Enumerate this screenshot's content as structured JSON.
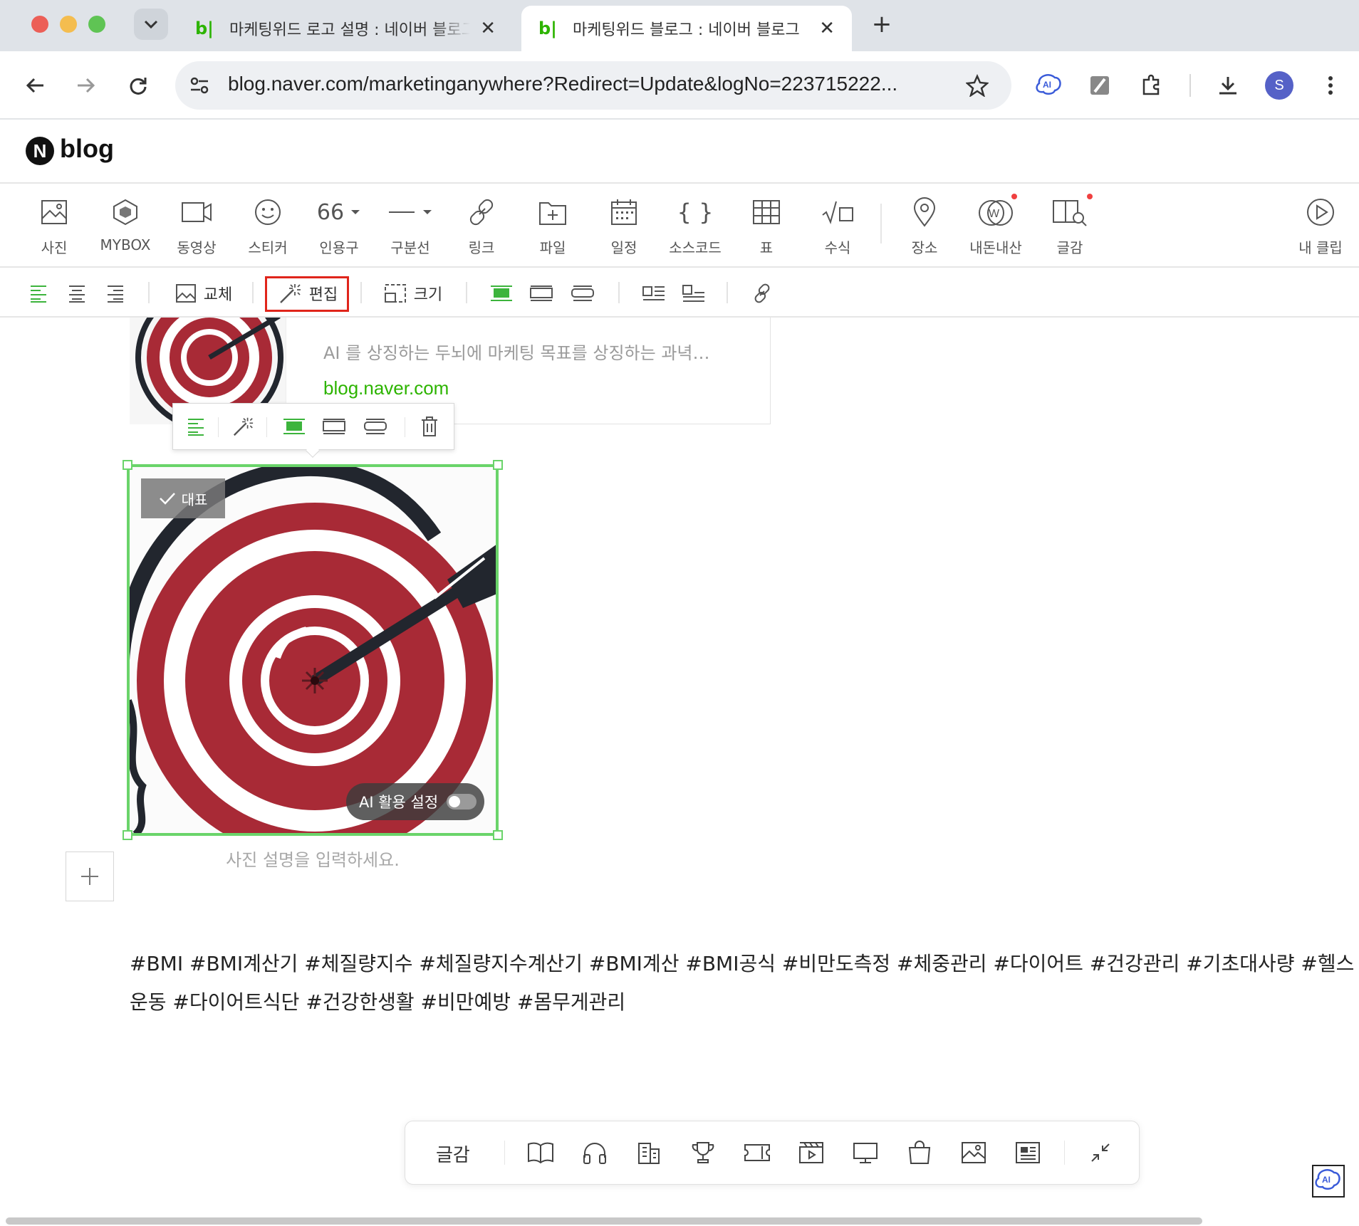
{
  "browser": {
    "tabs": [
      {
        "favicon": "b|",
        "title": "마케팅위드 로고 설명 : 네이버 블로그"
      },
      {
        "favicon": "b|",
        "title": "마케팅위드 블로그 : 네이버 블로그"
      }
    ],
    "tab_close": "✕",
    "new_tab": "+",
    "url": "blog.naver.com/marketinganywhere?Redirect=Update&logNo=223715222...",
    "profile_initial": "S",
    "ai_ext_label": "AI"
  },
  "blog": {
    "logo_letter": "N",
    "logo_word": "blog"
  },
  "insert_toolbar": {
    "items": [
      {
        "label": "사진",
        "icon": "photo-icon"
      },
      {
        "label": "MYBOX",
        "icon": "mybox-icon"
      },
      {
        "label": "동영상",
        "icon": "video-icon"
      },
      {
        "label": "스티커",
        "icon": "sticker-icon"
      },
      {
        "label": "인용구",
        "icon": "quote-icon",
        "glyph": "66"
      },
      {
        "label": "구분선",
        "icon": "divider-icon"
      },
      {
        "label": "링크",
        "icon": "link-icon"
      },
      {
        "label": "파일",
        "icon": "file-icon"
      },
      {
        "label": "일정",
        "icon": "calendar-icon"
      },
      {
        "label": "소스코드",
        "icon": "code-icon",
        "glyph": "{ }"
      },
      {
        "label": "표",
        "icon": "table-icon"
      },
      {
        "label": "수식",
        "icon": "formula-icon"
      },
      {
        "label": "장소",
        "icon": "place-icon"
      },
      {
        "label": "내돈내산",
        "icon": "my-money-icon",
        "glyph": "W"
      },
      {
        "label": "글감",
        "icon": "material-icon"
      },
      {
        "label": "내 클립",
        "icon": "clip-icon"
      }
    ]
  },
  "format_toolbar": {
    "replace_label": "교체",
    "edit_label": "편집",
    "size_label": "크기"
  },
  "content": {
    "link_card": {
      "description": "AI 를 상징하는 두뇌에 마케팅 목표를 상징하는 과녁…",
      "domain": "blog.naver.com"
    },
    "image": {
      "representative_label": "대표",
      "ai_setting_label": "AI 활용 설정",
      "caption_placeholder": "사진 설명을 입력하세요."
    },
    "hashtags_line1": "#BMI #BMI계산기 #체질량지수 #체질량지수계산기 #BMI계산 #BMI공식 #비만도측정 #체중관리 #다이어트 #건강관리 #기초대사량 #헬스",
    "hashtags_line2": "운동 #다이어트식단 #건강한생활 #비만예방 #몸무게관리"
  },
  "bottom_bar": {
    "label": "글감",
    "icons": [
      "book-icon",
      "music-icon",
      "building-icon",
      "trophy-icon",
      "ticket-icon",
      "movie-icon",
      "tv-icon",
      "shopping-icon",
      "image-icon",
      "news-icon",
      "collapse-icon"
    ]
  },
  "colors": {
    "accent_green": "#2db400",
    "selection_green": "#6ad46a",
    "highlight_red": "#e0251b",
    "target_red": "#a82a36"
  }
}
